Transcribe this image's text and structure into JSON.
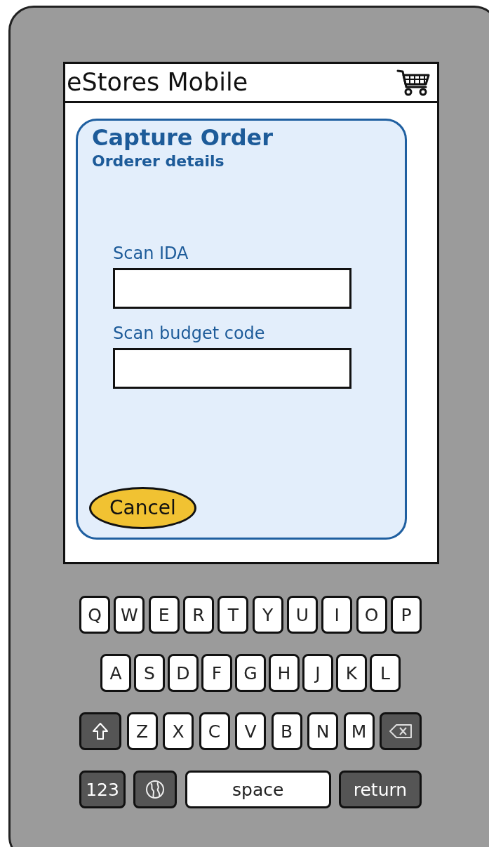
{
  "app_bar": {
    "title": "eStores Mobile"
  },
  "panel": {
    "title": "Capture Order",
    "subtitle": "Orderer details"
  },
  "fields": [
    {
      "label": "Scan IDA"
    },
    {
      "label": "Scan budget code"
    }
  ],
  "cancel_button": {
    "label": "Cancel"
  },
  "keyboard": {
    "rows": [
      {
        "keys": [
          {
            "kind": "letter",
            "label": "Q"
          },
          {
            "kind": "letter",
            "label": "W"
          },
          {
            "kind": "letter",
            "label": "E"
          },
          {
            "kind": "letter",
            "label": "R"
          },
          {
            "kind": "letter",
            "label": "T"
          },
          {
            "kind": "letter",
            "label": "Y"
          },
          {
            "kind": "letter",
            "label": "U"
          },
          {
            "kind": "letter",
            "label": "I"
          },
          {
            "kind": "letter",
            "label": "O"
          },
          {
            "kind": "letter",
            "label": "P"
          }
        ]
      },
      {
        "keys": [
          {
            "kind": "letter",
            "label": "A"
          },
          {
            "kind": "letter",
            "label": "S"
          },
          {
            "kind": "letter",
            "label": "D"
          },
          {
            "kind": "letter",
            "label": "F"
          },
          {
            "kind": "letter",
            "label": "G"
          },
          {
            "kind": "letter",
            "label": "H"
          },
          {
            "kind": "letter",
            "label": "J"
          },
          {
            "kind": "letter",
            "label": "K"
          },
          {
            "kind": "letter",
            "label": "L"
          }
        ]
      },
      {
        "keys": [
          {
            "kind": "shift"
          },
          {
            "kind": "letter",
            "label": "Z"
          },
          {
            "kind": "letter",
            "label": "X"
          },
          {
            "kind": "letter",
            "label": "C"
          },
          {
            "kind": "letter",
            "label": "V"
          },
          {
            "kind": "letter",
            "label": "B"
          },
          {
            "kind": "letter",
            "label": "N"
          },
          {
            "kind": "letter",
            "label": "M"
          },
          {
            "kind": "backspace"
          }
        ]
      },
      {
        "keys": [
          {
            "kind": "mode",
            "label": "123"
          },
          {
            "kind": "globe"
          },
          {
            "kind": "space",
            "label": "space"
          },
          {
            "kind": "return",
            "label": "return"
          }
        ]
      }
    ]
  }
}
